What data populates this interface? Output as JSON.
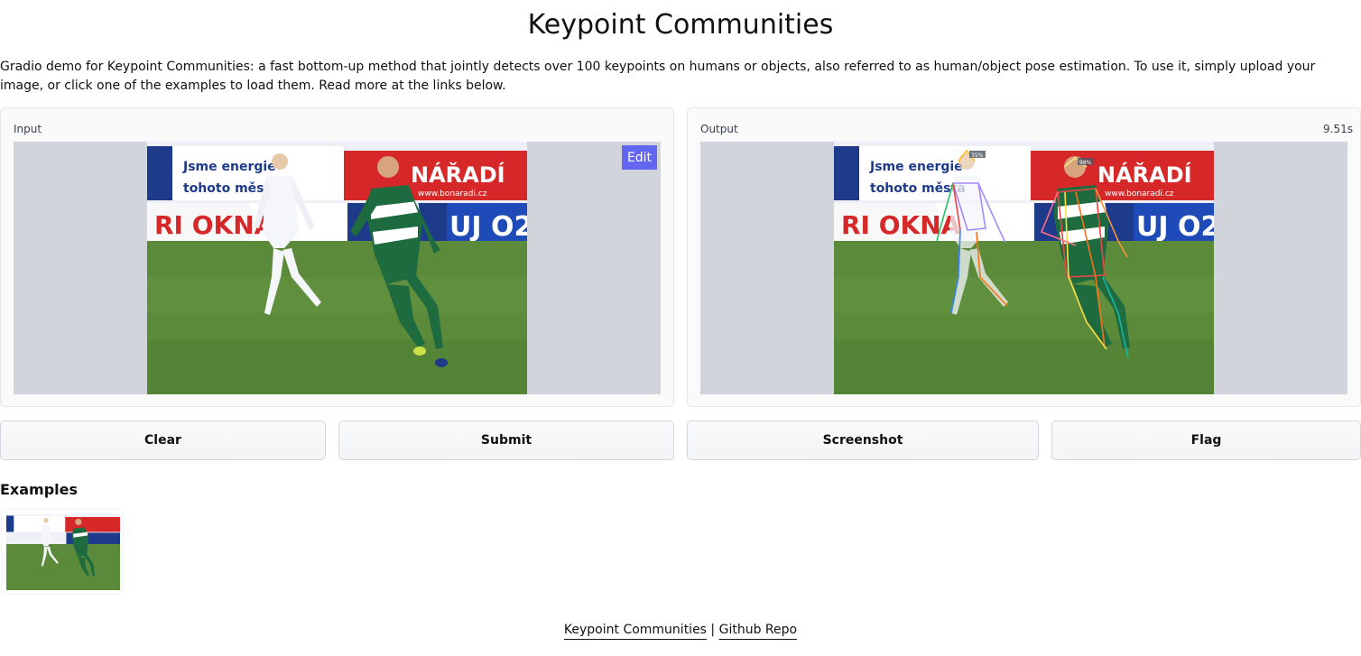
{
  "page": {
    "title": "Keypoint Communities",
    "description": "Gradio demo for Keypoint Communities: a fast bottom-up method that jointly detects over 100 keypoints on humans or objects, also referred to as human/object pose estimation. To use it, simply upload your image, or click one of the examples to load them. Read more at the links below."
  },
  "input_panel": {
    "label": "Input",
    "edit_label": "Edit"
  },
  "output_panel": {
    "label": "Output",
    "timer": "9.51s"
  },
  "buttons": {
    "clear": "Clear",
    "submit": "Submit",
    "screenshot": "Screenshot",
    "flag": "Flag"
  },
  "examples": {
    "title": "Examples"
  },
  "footer": {
    "link1": "Keypoint Communities",
    "separator": " | ",
    "link2": "Github Repo"
  },
  "photo_text": {
    "banner1": "Jsme energie",
    "banner1b": "tohoto města",
    "banner2": "NÁŘADÍ",
    "banner2b": "www.bonaradi.cz",
    "banner3": "RI OKNA",
    "banner4": "UJ O2",
    "score1": "35%",
    "score2": "98%"
  },
  "colors": {
    "accent": "#6366f1",
    "pitch": "#5b8a3a",
    "jersey_green": "#1f6b40",
    "banner_red": "#d62828"
  }
}
